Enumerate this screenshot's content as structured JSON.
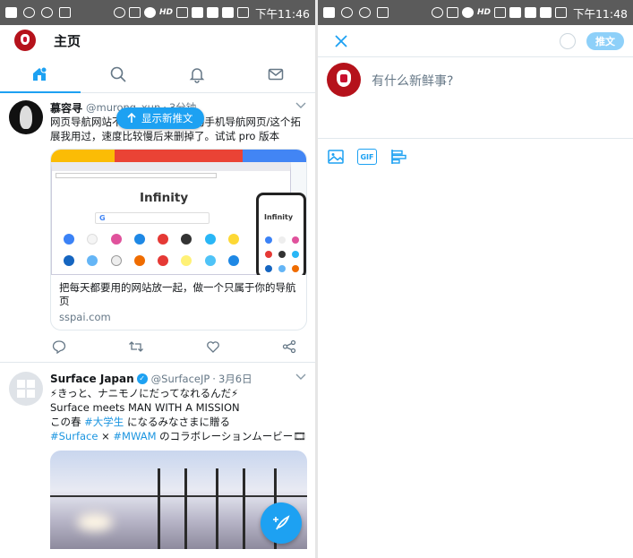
{
  "left": {
    "status_bar": {
      "time": "下午11:46",
      "hd": "HD"
    },
    "header": {
      "title": "主页"
    },
    "tabs": [
      {
        "icon": "home-icon"
      },
      {
        "icon": "search-icon"
      },
      {
        "icon": "bell-icon"
      },
      {
        "icon": "mail-icon"
      }
    ],
    "new_tweets_pill": {
      "label": "显示新推文"
    },
    "tweets": [
      {
        "name": "慕容寻",
        "handle": "@murong_xun",
        "time": "3分钟",
        "text": "网页导航网站不能同步，可同步的手机导航网页/这个拓展我用过，速度比较慢后来删掉了。试试 pro 版本",
        "card": {
          "image": {
            "title": "Infinity",
            "search_letter": "G",
            "phone_title": "Infinity"
          },
          "description": "把每天都要用的网站放一起，做一个只属于你的导航页",
          "domain": "sspai.com"
        }
      },
      {
        "name": "Surface Japan",
        "handle": "@SurfaceJP",
        "time": "3月6日",
        "line1": "⚡きっと、ナニモノにだってなれるんだ⚡",
        "line2": "Surface meets MAN WITH A MISSION",
        "line3_pre": "この春 ",
        "line3_tag": "#大学生",
        "line3_post": " になるみなさまに贈る",
        "line4_tag1": "#Surface",
        "line4_mid": " × ",
        "line4_tag2": "#MWAM",
        "line4_post": " のコラボレーションムービー🎞"
      }
    ]
  },
  "right": {
    "status_bar": {
      "time": "下午11:48",
      "hd": "HD"
    },
    "compose": {
      "tweet_button": "推文",
      "placeholder": "有什么新鲜事?",
      "tools": [
        {
          "icon": "image-icon"
        },
        {
          "icon": "gif-icon",
          "label": "GIF"
        },
        {
          "icon": "poll-icon"
        }
      ]
    }
  },
  "colors": {
    "accent": "#1da1f2",
    "link": "#1b95e0",
    "muted": "#657786",
    "statusbar": "#5b5b5b"
  }
}
